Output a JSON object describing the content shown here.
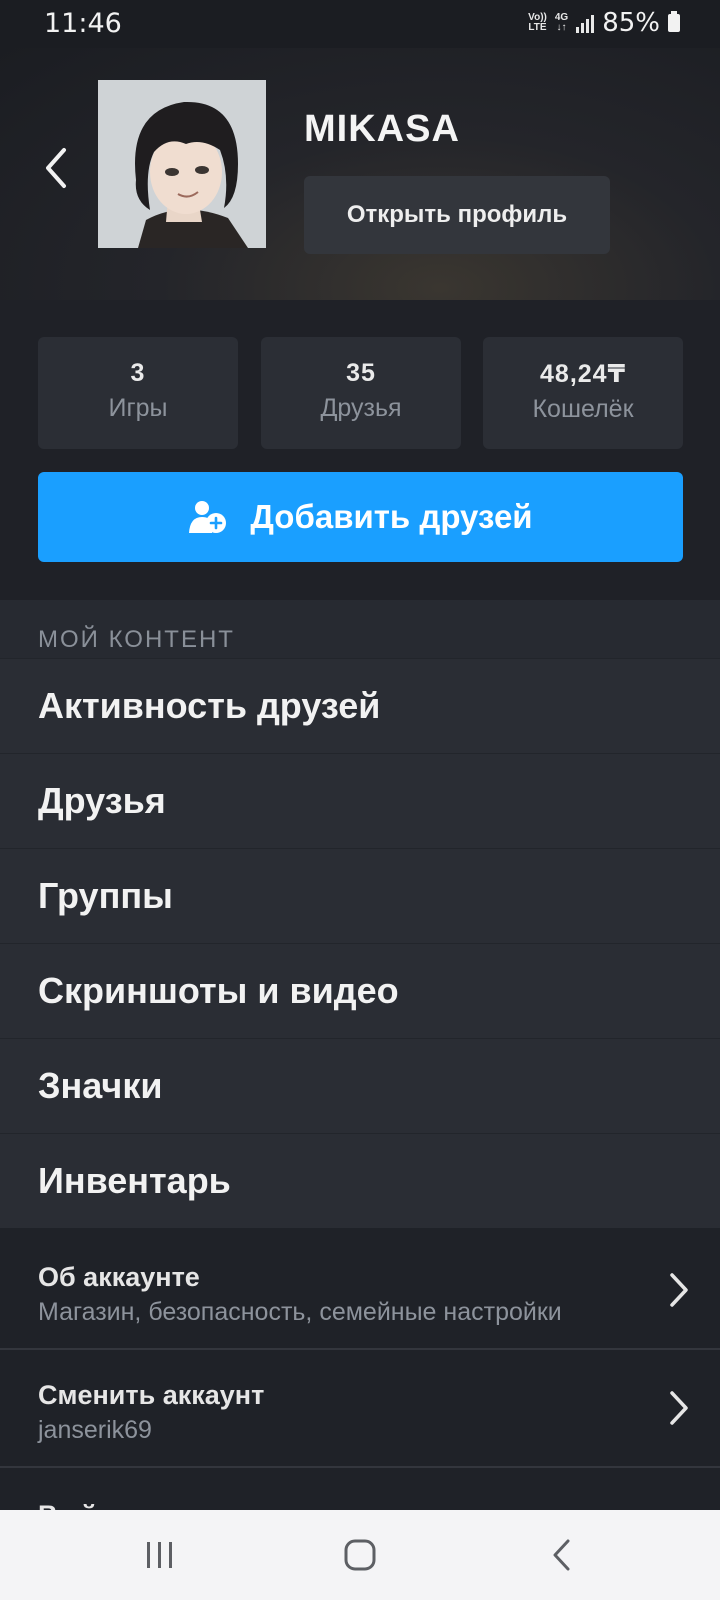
{
  "status_bar": {
    "time": "11:46",
    "volte_top": "Vo))",
    "volte_bottom": "LTE",
    "network": "4G",
    "network_arrows": "↓↑",
    "battery": "85%"
  },
  "profile": {
    "username": "MIKASA",
    "open_profile_label": "Открыть профиль",
    "avatar_icon": "avatar-image",
    "back_icon": "chevron-left-icon"
  },
  "stats": [
    {
      "value": "3",
      "label": "Игры"
    },
    {
      "value": "35",
      "label": "Друзья"
    },
    {
      "value": "48,24₸",
      "label": "Кошелёк"
    }
  ],
  "add_friends": {
    "label": "Добавить друзей",
    "icon": "add-user-icon",
    "color": "#1a9fff"
  },
  "my_content": {
    "header": "МОЙ КОНТЕНТ",
    "items": [
      "Активность друзей",
      "Друзья",
      "Группы",
      "Скриншоты и видео",
      "Значки",
      "Инвентарь"
    ]
  },
  "account": {
    "rows": [
      {
        "title": "Об аккаунте",
        "subtitle": "Магазин, безопасность, семейные настройки"
      },
      {
        "title": "Сменить аккаунт",
        "subtitle": "janserik69"
      }
    ],
    "logout_partial": "Выйти"
  },
  "nav_bar": {
    "icons": [
      "recent-apps-icon",
      "home-icon",
      "back-icon"
    ]
  }
}
